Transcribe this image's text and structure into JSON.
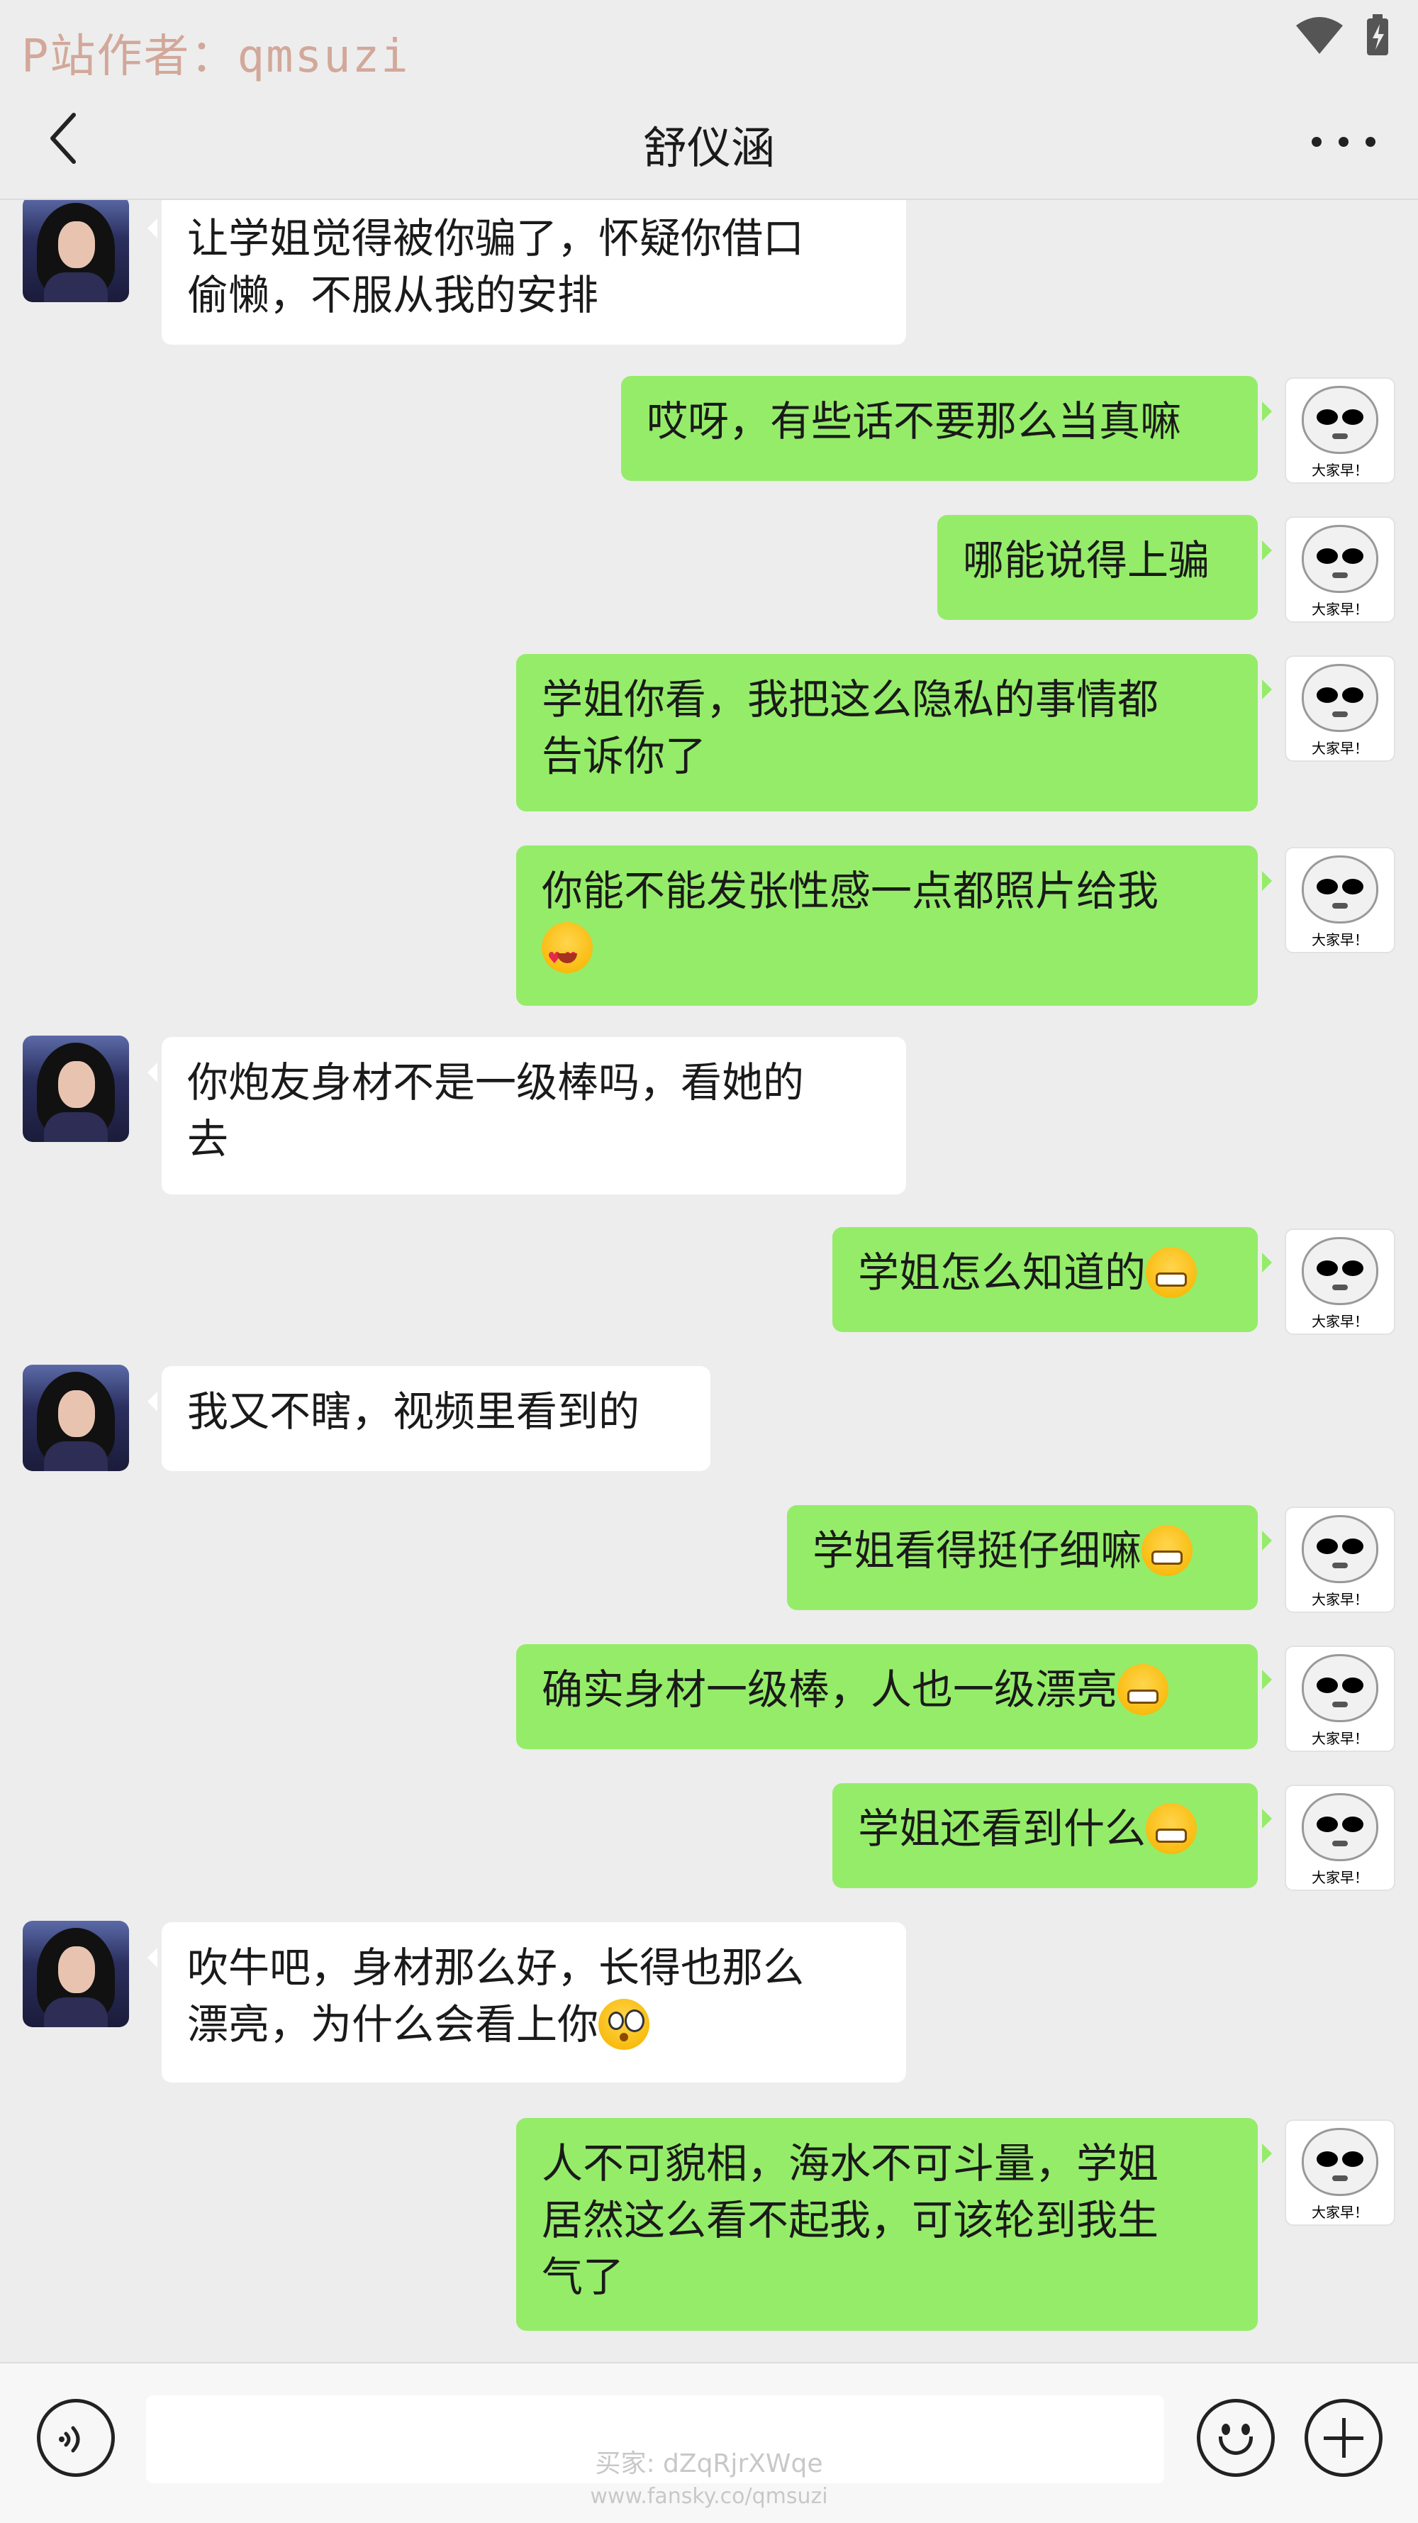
{
  "status_bar": {
    "watermark": "P站作者：qmsuzi",
    "icons": [
      "wifi-icon",
      "battery-icon"
    ]
  },
  "header": {
    "title": "舒仪涵",
    "back_icon": "chevron-left-icon",
    "more_icon": "more-icon"
  },
  "messages": [
    {
      "side": "left",
      "text": "让学姐觉得被你骗了，怀疑你借口\n偷懒，不服从我的安排"
    },
    {
      "side": "right",
      "text": "哎呀，有些话不要那么当真嘛"
    },
    {
      "side": "right",
      "text": "哪能说得上骗"
    },
    {
      "side": "right",
      "text": "学姐你看，我把这么隐私的事情都\n告诉你了"
    },
    {
      "side": "right",
      "text": "你能不能发张性感一点都照片给我\n",
      "emoji": "heart-eyes"
    },
    {
      "side": "left",
      "text": "你炮友身材不是一级棒吗，看她的\n去"
    },
    {
      "side": "right",
      "text": "学姐怎么知道的",
      "emoji": "grin"
    },
    {
      "side": "left",
      "text": "我又不瞎，视频里看到的"
    },
    {
      "side": "right",
      "text": "学姐看得挺仔细嘛",
      "emoji": "grin"
    },
    {
      "side": "right",
      "text": "确实身材一级棒，人也一级漂亮",
      "emoji": "grin"
    },
    {
      "side": "right",
      "text": "学姐还看到什么",
      "emoji": "grin"
    },
    {
      "side": "left",
      "text": "吹牛吧，身材那么好，长得也那么\n漂亮，为什么会看上你",
      "emoji": "flushed"
    },
    {
      "side": "right",
      "text": "人不可貌相，海水不可斗量，学姐\n居然这么看不起我，可该轮到我生\n气了"
    }
  ],
  "avatar_right_caption": "大家早！",
  "input_bar": {
    "voice_icon": "voice-icon",
    "emoji_icon": "smiley-icon",
    "plus_icon": "plus-icon",
    "watermark_buyer": "买家: dZqRjrXWqe",
    "watermark_url": "www.fansky.co/qmsuzi"
  }
}
